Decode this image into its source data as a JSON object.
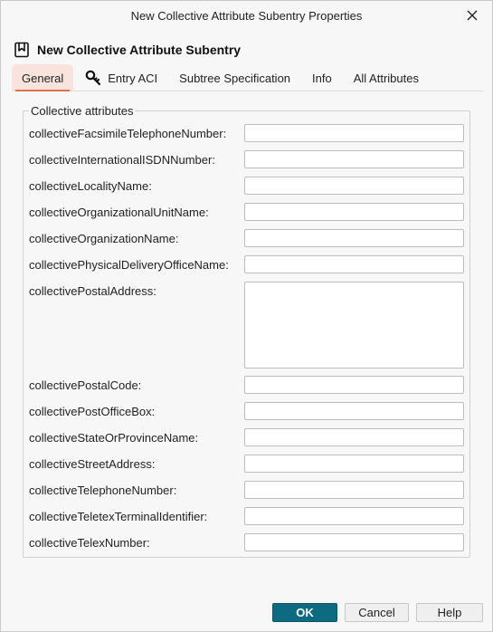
{
  "window": {
    "title": "New Collective Attribute Subentry Properties"
  },
  "header": {
    "title": "New Collective Attribute Subentry",
    "icon": "bookmark-icon"
  },
  "tabs": [
    {
      "label": "General",
      "active": true
    },
    {
      "label": "Entry ACI",
      "icon": "key-icon"
    },
    {
      "label": "Subtree Specification"
    },
    {
      "label": "Info"
    },
    {
      "label": "All Attributes"
    }
  ],
  "group": {
    "legend": "Collective attributes",
    "fields": [
      {
        "label": "collectiveFacsimileTelephoneNumber:",
        "value": ""
      },
      {
        "label": "collectiveInternationalISDNNumber:",
        "value": ""
      },
      {
        "label": "collectiveLocalityName:",
        "value": ""
      },
      {
        "label": "collectiveOrganizationalUnitName:",
        "value": ""
      },
      {
        "label": "collectiveOrganizationName:",
        "value": ""
      },
      {
        "label": "collectivePhysicalDeliveryOfficeName:",
        "value": ""
      },
      {
        "label": "collectivePostalAddress:",
        "value": ""
      },
      {
        "label": "collectivePostalCode:",
        "value": ""
      },
      {
        "label": "collectivePostOfficeBox:",
        "value": ""
      },
      {
        "label": "collectiveStateOrProvinceName:",
        "value": ""
      },
      {
        "label": "collectiveStreetAddress:",
        "value": ""
      },
      {
        "label": "collectiveTelephoneNumber:",
        "value": ""
      },
      {
        "label": "collectiveTeletexTerminalIdentifier:",
        "value": ""
      },
      {
        "label": "collectiveTelexNumber:",
        "value": ""
      }
    ]
  },
  "buttons": {
    "ok": "OK",
    "cancel": "Cancel",
    "help": "Help"
  },
  "colors": {
    "primary": "#0e6a80",
    "tab_accent": "#e0734f",
    "tab_active_bg": "#f9e3dc"
  }
}
